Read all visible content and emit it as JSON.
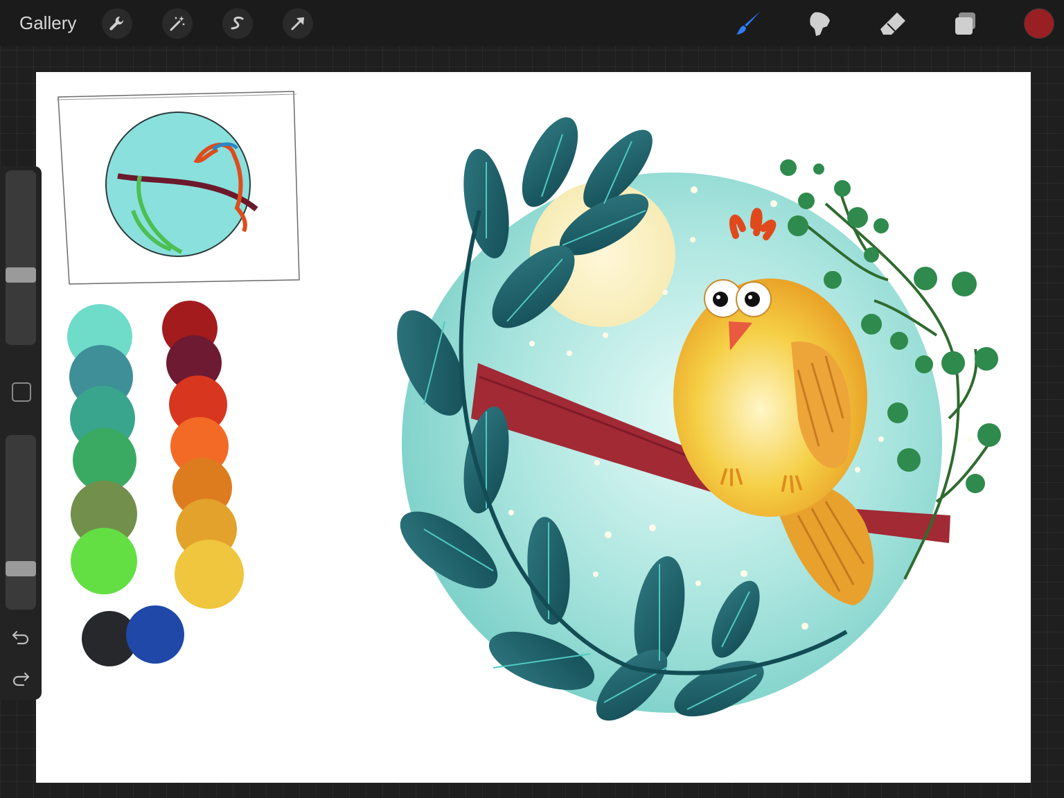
{
  "topbar": {
    "gallery_label": "Gallery",
    "left_tools": [
      "wrench-icon",
      "magic-wand-icon",
      "selection-s-icon",
      "arrow-transform-icon"
    ],
    "right_tools": [
      "brush-icon",
      "smudge-icon",
      "eraser-icon",
      "layers-icon"
    ],
    "current_color": "#9a1f22",
    "active_tool_color": "#2f7df6"
  },
  "sidebar": {
    "controls": [
      "brush-size-slider",
      "modify-square-button",
      "opacity-slider",
      "undo-icon",
      "redo-icon"
    ]
  },
  "canvas": {
    "background": "#ffffff",
    "palette_left": [
      "#6fdcc9",
      "#3e8f98",
      "#3aa58d",
      "#3aaa62",
      "#738f4c",
      "#63df44"
    ],
    "palette_right": [
      "#a31b1d",
      "#6d1a32",
      "#d9361f",
      "#f26a26",
      "#dd7c1f",
      "#e3a22b",
      "#efc63d"
    ],
    "palette_bottom": [
      "#26282b",
      "#1f48a8"
    ]
  }
}
